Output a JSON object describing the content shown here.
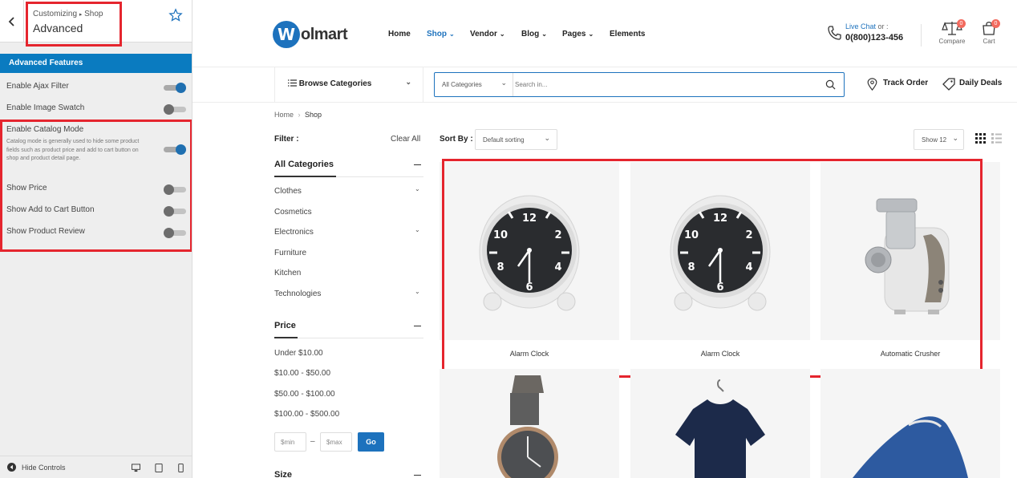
{
  "customizer": {
    "breadcrumb_root": "Customizing",
    "breadcrumb_sep": "▸",
    "breadcrumb_leaf": "Shop",
    "panel_title": "Advanced",
    "section_title": "Advanced Features",
    "options": [
      {
        "label": "Enable Ajax Filter",
        "enabled": true
      },
      {
        "label": "Enable Image Swatch",
        "enabled": false
      },
      {
        "label": "Enable Catalog Mode",
        "enabled": true
      },
      {
        "label": "Show Price",
        "enabled": false
      },
      {
        "label": "Show Add to Cart Button",
        "enabled": false
      },
      {
        "label": "Show Product Review",
        "enabled": false
      }
    ],
    "catalog_description": "Catalog mode is generally used to hide some product fields such as product price and add to cart button on shop and product detail page.",
    "hide_controls": "Hide Controls",
    "accent_color": "#0a7bc0"
  },
  "store": {
    "logo_mark": "W",
    "logo_text": "olmart",
    "nav": [
      "Home",
      "Shop",
      "Vendor",
      "Blog",
      "Pages",
      "Elements"
    ],
    "live_chat": "Live Chat",
    "live_chat_suffix": "or :",
    "phone": "0(800)123-456",
    "compare_label": "Compare",
    "compare_count": "0",
    "cart_label": "Cart",
    "cart_count": "0",
    "browse_categories": "Browse Categories",
    "search_category": "All Categories",
    "search_placeholder": "Search in...",
    "track_order": "Track Order",
    "daily_deals": "Daily Deals",
    "brand_color": "#1d72bd"
  },
  "shop": {
    "breadcrumb": [
      "Home",
      "Shop"
    ],
    "filter_label": "Filter :",
    "clear_all": "Clear All",
    "categories_title": "All Categories",
    "categories": [
      "Clothes",
      "Cosmetics",
      "Electronics",
      "Furniture",
      "Kitchen",
      "Technologies"
    ],
    "price_title": "Price",
    "price_ranges": [
      "Under $10.00",
      "$10.00 - $50.00",
      "$50.00 - $100.00",
      "$100.00 - $500.00"
    ],
    "min_placeholder": "$min",
    "max_placeholder": "$max",
    "range_dash": "–",
    "go_label": "Go",
    "size_title": "Size",
    "sort_label": "Sort By :",
    "sort_value": "Default sorting",
    "show_value": "Show 12",
    "products": [
      "Alarm Clock",
      "Alarm Clock",
      "Automatic Crusher"
    ]
  }
}
